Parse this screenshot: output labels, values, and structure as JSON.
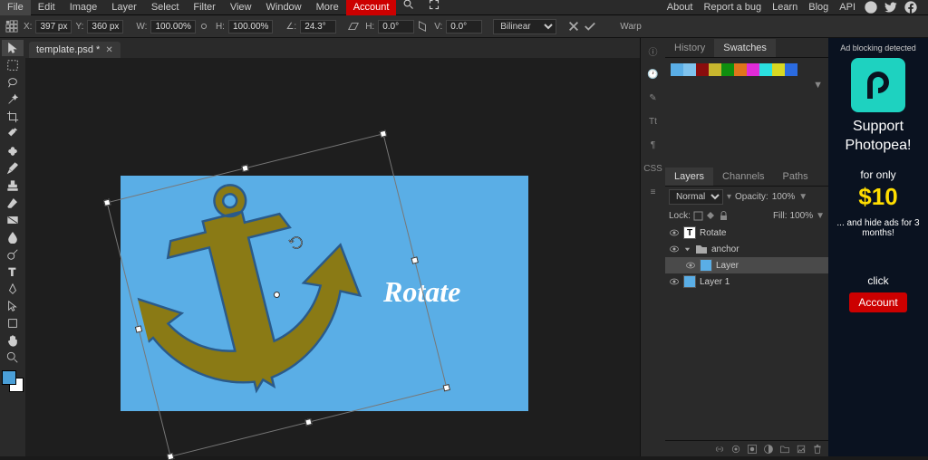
{
  "menu": [
    "File",
    "Edit",
    "Image",
    "Layer",
    "Select",
    "Filter",
    "View",
    "Window",
    "More"
  ],
  "menu_account": "Account",
  "top_links": [
    "About",
    "Report a bug",
    "Learn",
    "Blog",
    "API"
  ],
  "options": {
    "x_lbl": "X:",
    "x": "397 px",
    "y_lbl": "Y:",
    "y": "360 px",
    "w_lbl": "W:",
    "w": "100.00%",
    "h_lbl": "H:",
    "h": "100.00%",
    "a_lbl": "∠:",
    "a": "24.3°",
    "sh_lbl": "H:",
    "sh": "0.0°",
    "sv_lbl": "V:",
    "sv": "0.0°",
    "interp": "Bilinear",
    "warp": "Warp"
  },
  "tab": {
    "name": "template.psd *"
  },
  "canvas_text": "Rotate",
  "panel1_tabs": [
    "History",
    "Swatches"
  ],
  "swatch_colors": [
    "#5aaee6",
    "#7fc3ee",
    "#8a0d0d",
    "#c7b62e",
    "#0f8f0f",
    "#e0751b",
    "#e02bd8",
    "#2be0e0",
    "#d8d822",
    "#2b6be0"
  ],
  "panel2_tabs": [
    "Layers",
    "Channels",
    "Paths"
  ],
  "layer_opts": {
    "blend": "Normal",
    "op_lbl": "Opacity:",
    "op": "100%",
    "lock_lbl": "Lock:",
    "fill_lbl": "Fill:",
    "fill": "100%"
  },
  "layers": [
    {
      "name": "Rotate",
      "type": "text"
    },
    {
      "name": "anchor",
      "type": "folder"
    },
    {
      "name": "Layer",
      "type": "raster",
      "sel": true,
      "indent": true
    },
    {
      "name": "Layer 1",
      "type": "raster"
    }
  ],
  "quick": [
    "ⓘ",
    "🕐",
    "✎",
    "Tt",
    "¶",
    "CSS",
    "≡"
  ],
  "ad": {
    "top": "Ad blocking detected",
    "support": "Support Photopea!",
    "for": "for only",
    "price": "$10",
    "hide": "... and hide ads for 3 months!",
    "click": "click",
    "btn": "Account"
  }
}
